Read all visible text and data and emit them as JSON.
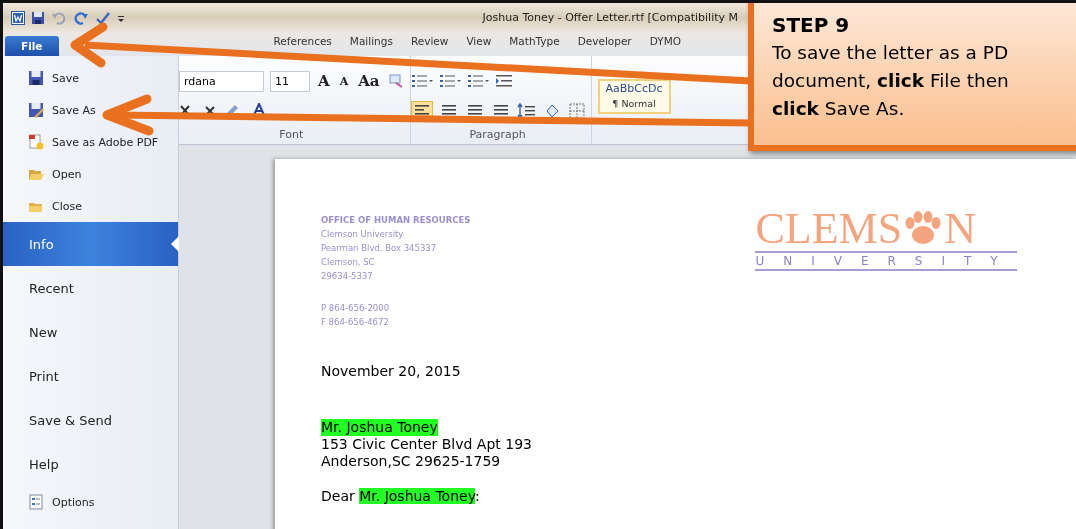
{
  "window": {
    "title": "Joshua Toney - Offer Letter.rtf [Compatibility M"
  },
  "tabs": [
    {
      "label": "File",
      "selected": true
    },
    {
      "label": "References",
      "selected": false
    },
    {
      "label": "Mailings",
      "selected": false
    },
    {
      "label": "Review",
      "selected": false
    },
    {
      "label": "View",
      "selected": false
    },
    {
      "label": "MathType",
      "selected": false
    },
    {
      "label": "Developer",
      "selected": false
    },
    {
      "label": "DYMO",
      "selected": false
    }
  ],
  "ribbon": {
    "font_name": "rdana",
    "font_size": "11",
    "font_buttons": [
      "A",
      "A",
      "Aa"
    ],
    "style_sample": "AaBbCcDc",
    "style_name": "¶ Normal",
    "groups": [
      "Font",
      "Paragraph"
    ]
  },
  "file_menu": [
    {
      "label": "Save",
      "kind": "command",
      "selected": false
    },
    {
      "label": "Save As",
      "kind": "command",
      "selected": false
    },
    {
      "label": "Save as Adobe PDF",
      "kind": "command",
      "selected": false
    },
    {
      "label": "Open",
      "kind": "command",
      "selected": false
    },
    {
      "label": "Close",
      "kind": "command",
      "selected": false
    },
    {
      "label": "Info",
      "kind": "section",
      "selected": true
    },
    {
      "label": "Recent",
      "kind": "section",
      "selected": false
    },
    {
      "label": "New",
      "kind": "section",
      "selected": false
    },
    {
      "label": "Print",
      "kind": "section",
      "selected": false
    },
    {
      "label": "Save & Send",
      "kind": "section",
      "selected": false
    },
    {
      "label": "Help",
      "kind": "section",
      "selected": false
    },
    {
      "label": "Options",
      "kind": "command",
      "selected": false
    }
  ],
  "letter": {
    "letterhead": [
      "OFFICE OF HUMAN RESOURCES",
      "Clemson University",
      "Pearman Blvd. Box 345337",
      "Clemson, SC",
      "29634-5337"
    ],
    "contact": [
      "P 864-656-2000",
      "F 864-656-4672"
    ],
    "logo": {
      "wordmark_left": "CLEMS",
      "wordmark_right": "N",
      "subtitle": "UNIVERSITY"
    },
    "date": "November 20, 2015",
    "recipient_name": {
      "text": "Mr. Joshua Toney",
      "highlighted": true
    },
    "address": [
      "153 Civic Center Blvd Apt 193",
      "Anderson,SC 29625-1759"
    ],
    "salutation": {
      "before": "Dear ",
      "name": "Mr. Joshua Toney",
      "after": ":",
      "highlighted": true
    }
  },
  "callout": {
    "title": "STEP 9",
    "lines": [
      "To save the letter as a PD",
      "document, **click** File then",
      "**click** Save As."
    ]
  }
}
